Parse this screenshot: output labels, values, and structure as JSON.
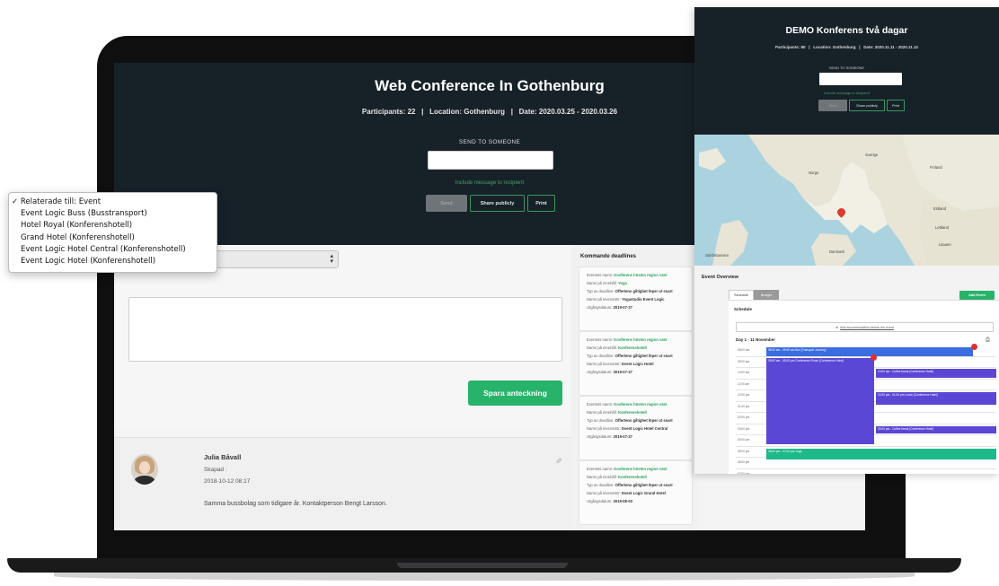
{
  "main": {
    "title": "Web Conference In Gothenburg",
    "meta": "Participants: 22   |   Location: Gothenburg   |   Date: 2020.03.25 - 2020.03.26",
    "send_label": "SEND TO SOMEONE",
    "include_message": "Include message to recipient",
    "buttons": {
      "send": "Send",
      "share": "Share publicly",
      "print": "Print"
    }
  },
  "note": {
    "dropdown_options": [
      "✓ Relaterade till: Event",
      "Event Logic Buss (Busstransport)",
      "Hotel Royal (Konferenshotell)",
      "Grand Hotel (Konferenshotell)",
      "Event Logic Hotel Central (Konferenshotell)",
      "Event Logic Hotel (Konferenshotell)"
    ],
    "save_label": "Spara anteckning"
  },
  "comment": {
    "name": "Julia Båvall",
    "subtitle": "Skapad :",
    "date": "2018-10-12 08:17",
    "text": "Samma bussbolag som tidigare år. Kontaktperson Bengt Larsson."
  },
  "deadlines": {
    "title": "Kommande deadlines",
    "items": [
      {
        "event": "Konferens hösten region väst",
        "content": "Yoga",
        "type": "Offertens giltighet löper ut snart",
        "supplier": "Yogastudio Event Logic",
        "date": "2019-07-27"
      },
      {
        "event": "Konferens hösten region väst",
        "content": "Konferenshotell",
        "type": "Offertens giltighet löper ut snart",
        "supplier": "Event Logic Hotel",
        "date": "2019-07-27"
      },
      {
        "event": "Konferens hösten region väst",
        "content": "Konferenshotell",
        "type": "Offertens giltighet löper ut snart",
        "supplier": "Event Logic Hotel Central",
        "date": "2019-07-27"
      },
      {
        "event": "Konferens hösten region väst",
        "content": "Konferenshotell",
        "type": "Offertens giltighet löper ut snart",
        "supplier": "Event Logic Grand Hotel",
        "date": "2019-08-03"
      }
    ],
    "labels": {
      "event": "Eventets namn:",
      "content": "Namn på innehåll:",
      "type": "Typ av deadline:",
      "supplier": "Namn på leverantör:",
      "date": "Utgångsdatum:"
    }
  },
  "demo": {
    "title": "DEMO Konferens två dagar",
    "meta": "Participants: 80   |   Location: Gothenburg   |   Date: 2020.11.11 - 2020.11.12",
    "send_label": "SEND TO SOMEONE",
    "include_message": "Include message to recipient",
    "buttons": {
      "send": "Send",
      "share": "Share publicly",
      "print": "Print"
    },
    "map_labels": [
      "Norge",
      "Sverige",
      "Finland",
      "Estland",
      "Lettland",
      "Litauen",
      "Storbritannien",
      "Danmark"
    ],
    "overview_title": "Event Overview",
    "tabs": [
      "Schedule",
      "Budget"
    ],
    "add_event": "Add Event",
    "schedule_title": "Schedule",
    "accommodation": "Add accommodation before the event",
    "day": "Day 1 - 11 November",
    "times": [
      "08:00 am",
      "09:00 am",
      "10:00 am",
      "11:00 am",
      "12:00 pm",
      "01:00 pm",
      "02:00 pm",
      "03:00 pm",
      "04:00 pm",
      "05:00 pm",
      "06:00 pm",
      "07:00 pm"
    ],
    "events": {
      "bus": "08:00 am - 09:00 am  Bus (Transport Journey)",
      "conf": "09:00 am - 05:00 pm  Conference Room (Conference Hotel)",
      "coffee1": "10:00 am - Coffee break (Conference Hotel)",
      "lunch": "12:00 pm - 01:00 pm  Lunch (Conference Hotel)",
      "coffee2": "03:00 pm - Coffee break (Conference Hotel)",
      "yoga": "06:00 pm - 07:00 pm  Yoga"
    }
  }
}
